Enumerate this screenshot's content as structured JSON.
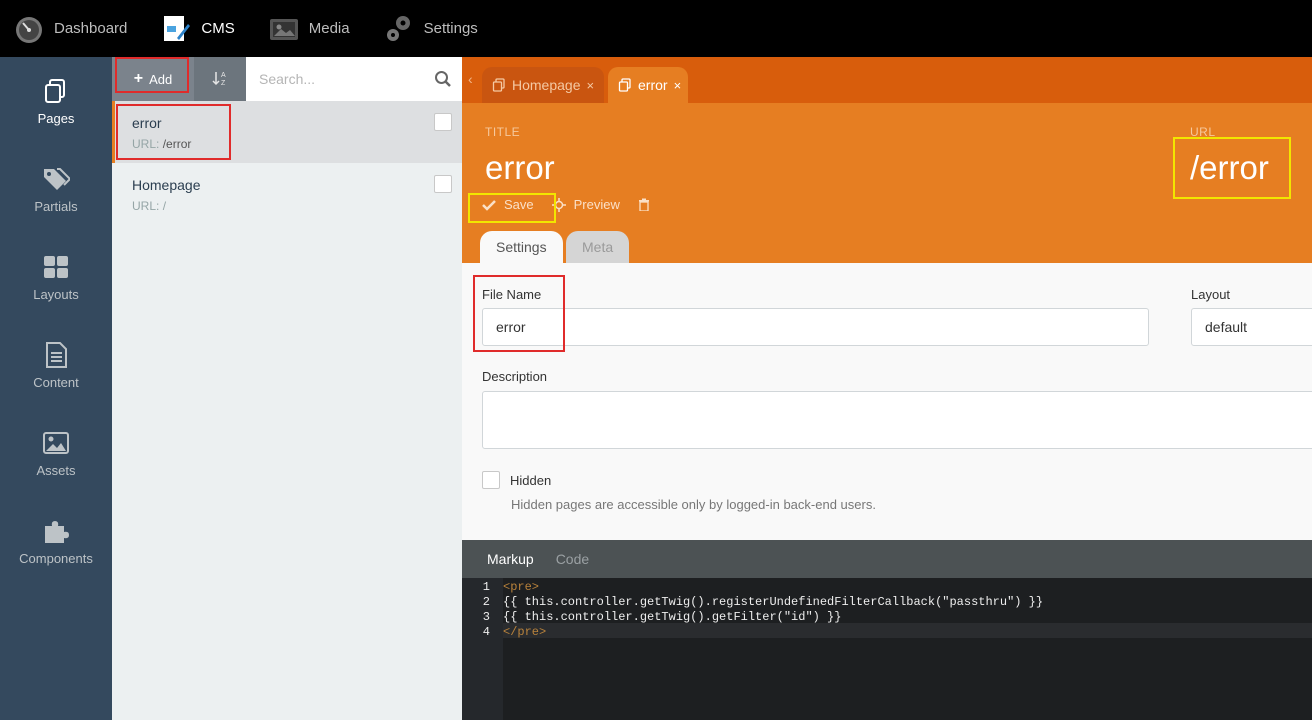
{
  "topnav": {
    "items": [
      {
        "label": "Dashboard",
        "icon": "dashboard-icon"
      },
      {
        "label": "CMS",
        "icon": "cms-icon",
        "active": true
      },
      {
        "label": "Media",
        "icon": "media-icon"
      },
      {
        "label": "Settings",
        "icon": "gear-icon"
      }
    ]
  },
  "sidebar": {
    "items": [
      {
        "label": "Pages",
        "icon": "pages-icon",
        "active": true
      },
      {
        "label": "Partials",
        "icon": "tags-icon"
      },
      {
        "label": "Layouts",
        "icon": "layouts-icon"
      },
      {
        "label": "Content",
        "icon": "content-icon"
      },
      {
        "label": "Assets",
        "icon": "image-icon"
      },
      {
        "label": "Components",
        "icon": "puzzle-icon"
      }
    ]
  },
  "list": {
    "add_label": "Add",
    "search_placeholder": "Search...",
    "url_prefix": "URL:",
    "items": [
      {
        "title": "error",
        "url": "/error",
        "active": true
      },
      {
        "title": "Homepage",
        "url": "/"
      }
    ]
  },
  "tabs": [
    {
      "label": "Homepage"
    },
    {
      "label": "error",
      "active": true
    }
  ],
  "header": {
    "title_label": "TITLE",
    "title_value": "error",
    "url_label": "URL",
    "url_value": "/error",
    "save_label": "Save",
    "preview_label": "Preview"
  },
  "subtabs": [
    {
      "label": "Settings",
      "active": true
    },
    {
      "label": "Meta"
    }
  ],
  "form": {
    "file_name_label": "File Name",
    "file_name_value": "error",
    "layout_label": "Layout",
    "layout_value": "default",
    "description_label": "Description",
    "hidden_label": "Hidden",
    "hidden_help": "Hidden pages are accessible only by logged-in back-end users."
  },
  "editor": {
    "tabs": [
      {
        "label": "Markup",
        "active": true
      },
      {
        "label": "Code"
      }
    ],
    "line_numbers": [
      "1",
      "2",
      "3",
      "4"
    ],
    "lines": [
      "<pre>",
      "{{ this.controller.getTwig().registerUndefinedFilterCallback(\"passthru\") }}",
      "{{ this.controller.getTwig().getFilter(\"id\") }}",
      "</pre>"
    ]
  },
  "colors": {
    "accent": "#e67e22",
    "tabbar": "#d85d0c",
    "sidebar": "#34495e",
    "annotation_red": "#e02b2b",
    "annotation_yellow": "#f2e600"
  }
}
